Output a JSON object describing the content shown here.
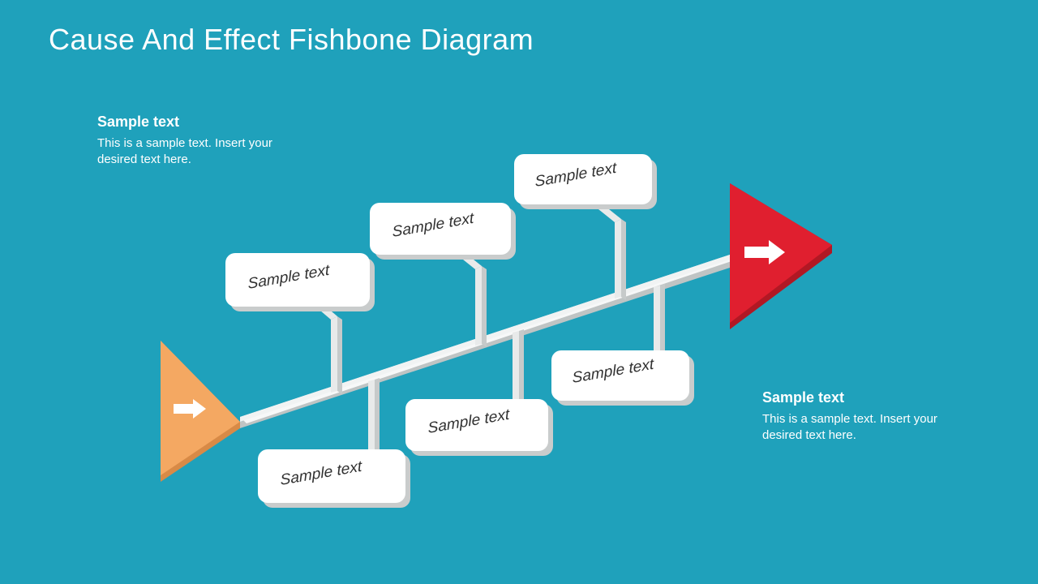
{
  "title": "Cause And Effect Fishbone Diagram",
  "note_left": {
    "heading": "Sample text",
    "body": "This is a sample text. Insert your desired text here."
  },
  "note_right": {
    "heading": "Sample text",
    "body": "This is a sample text. Insert your desired text here."
  },
  "cards": {
    "top1": "Sample text",
    "top2": "Sample text",
    "top3": "Sample text",
    "bottom1": "Sample text",
    "bottom2": "Sample text",
    "bottom3": "Sample text"
  },
  "colors": {
    "background": "#1fa1bb",
    "spine": "#f1f3f3",
    "spineShadow": "#bfc4c4",
    "cardFace": "#ffffff",
    "cardShadow": "#c9cccc",
    "headRed": "#e01f2f",
    "headRedDark": "#b11824",
    "tailOrange": "#f4a862",
    "tailOrangeDark": "#d88a46",
    "arrowIcon": "#ffffff"
  }
}
